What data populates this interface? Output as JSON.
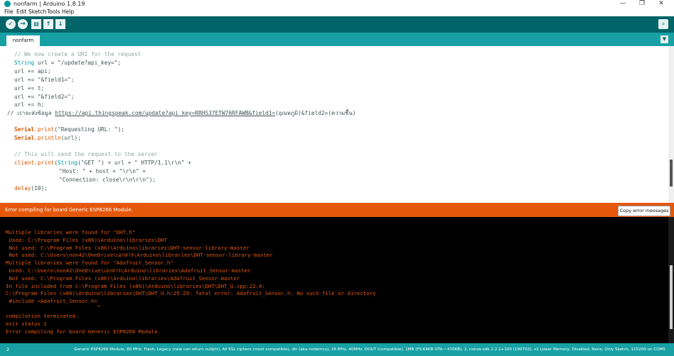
{
  "window": {
    "title": "nonfarm | Arduino 1.8.19",
    "minimize": "—",
    "maximize": "❐",
    "close": "✕"
  },
  "menu": [
    "File",
    "Edit",
    "Sketch",
    "Tools",
    "Help"
  ],
  "toolbar": {
    "verify_icon": "✓",
    "upload_icon": "→",
    "new_icon": "▤",
    "open_icon": "↑",
    "save_icon": "↓",
    "serial_monitor_icon": "⌕"
  },
  "tabs": {
    "active": "nonfarm",
    "menu_icon": "▼"
  },
  "editor": {
    "lines": {
      "l1": "// We now create a URI for the request",
      "l2_type": "String",
      "l2_rest": " url = \"/update?api_key=\";",
      "l3": "url += api;",
      "l4": "url += \"&field1=\";",
      "l5": "url += t;",
      "l6": "url += \"&field2=\";",
      "l7": "url += h;",
      "l8_prefix": "// เราจะส่งข้อมูล ",
      "l8_link": "https://api.thingspeak.com/update?api_key=RRHS37ETW76RFAWB&field1=",
      "l8_suffix": "(อุณหภูมิ)&field2=(ความชื้น)",
      "l9_obj": "Serial",
      "l9_fn": ".print",
      "l9_rest": "(\"Requesting URL: \");",
      "l10_obj": "Serial",
      "l10_fn": ".println",
      "l10_rest": "(url);",
      "l11": "// This will send the request to the server",
      "l12_fn": "client.print",
      "l12_a": "(",
      "l12_type": "String",
      "l12_rest": "(\"GET \") + url + \" HTTP/1.1\\r\\n\" +",
      "l13": "\"Host: \" + host + \"\\r\\n\" +",
      "l14": "\"Connection: close\\r\\n\\r\\n\");",
      "l15_fn": "delay",
      "l15_rest": "(10);"
    }
  },
  "error_bar": {
    "message": "Error compiling for board Generic ESP8266 Module.",
    "copy_button": "Copy error messages"
  },
  "console": {
    "lines": [
      "Multiple libraries were found for \"DHT.h\"",
      " Used: C:\\Program Files (x86)\\Arduino\\libraries\\DHT",
      " Not used: C:\\Program Files (x86)\\Arduino\\libraries\\DHT-sensor-library-master",
      " Not used: C:\\Users\\non42\\OneDrive\\เอกสาร\\Arduino\\libraries\\DHT-sensor-library-master",
      "Multiple libraries were found for \"Adafruit_Sensor.h\"",
      " Used: C:\\Users\\non42\\OneDrive\\เอกสาร\\Arduino\\libraries\\Adafruit_Sensor-master",
      " Not used: C:\\Program Files (x86)\\Arduino\\libraries\\Adafruit_Sensor-master",
      "In file included from C:\\Program Files (x86)\\Arduino\\libraries\\DHT\\DHT_U.cpp:22:0:",
      "C:\\Program Files (x86)\\Arduino\\libraries\\DHT\\DHT_U.h:25:29: fatal error: Adafruit_Sensor.h: No such file or directory",
      " #include <Adafruit_Sensor.h>",
      "                             ^",
      "compilation terminated.",
      "exit status 1",
      "Error compiling for board Generic ESP8266 Module."
    ]
  },
  "status_bar": {
    "line_number": "2",
    "board_info": "Generic ESP8266 Module, 80 MHz, Flash, Legacy (new can return nullptr), All SSL ciphers (most compatible), dtr (aka nodemcu), 26 MHz, 40MHz, DOUT (compatible), 1MB (FS:64KB OTA:~470KB), 2, nonos-sdk 2.2.1+100 (190703), v2 Lower Memory, Disabled, None, Only Sketch, 115200 on COM5"
  },
  "colors": {
    "toolbar": "#006468",
    "tabbar": "#17a1a5",
    "error_bar": "#e5580c",
    "console_text": "#e5580c",
    "console_bg": "#000000"
  }
}
